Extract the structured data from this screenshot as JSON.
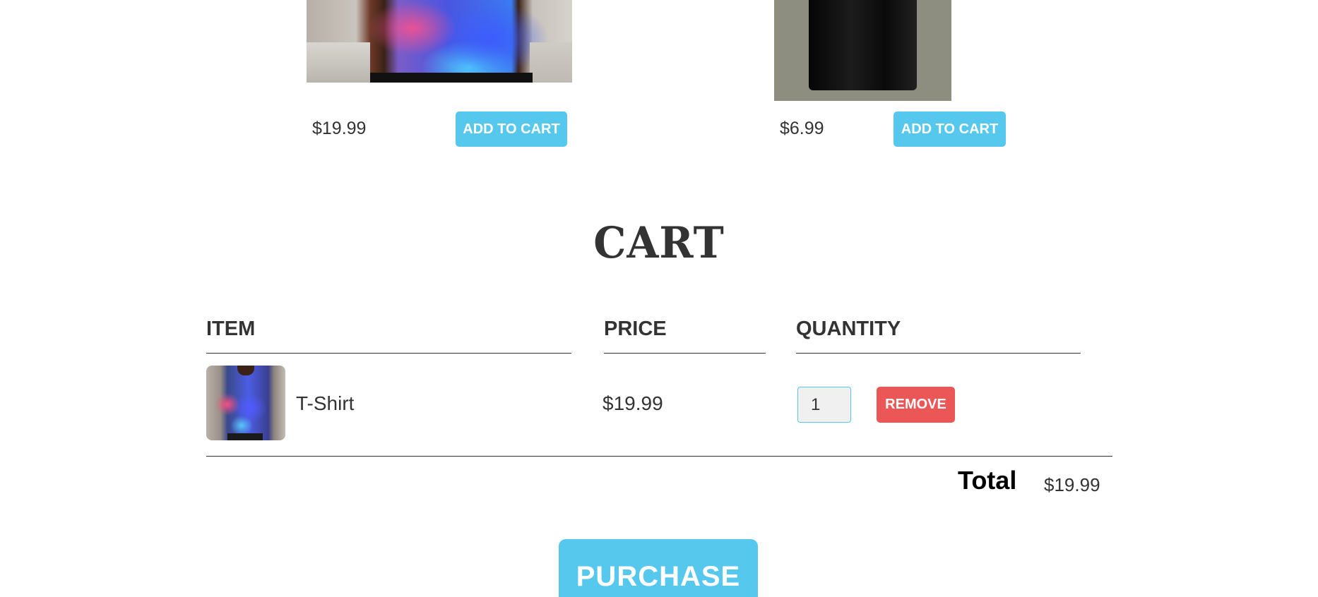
{
  "products": [
    {
      "image_alt": "T-Shirt",
      "price": "$19.99",
      "add_to_cart_label": "ADD TO CART"
    },
    {
      "image_alt": "Dress",
      "price": "$6.99",
      "add_to_cart_label": "ADD TO CART"
    }
  ],
  "cart": {
    "title": "CART",
    "columns": {
      "item": "ITEM",
      "price": "PRICE",
      "quantity": "QUANTITY"
    },
    "rows": [
      {
        "name": "T-Shirt",
        "price": "$19.99",
        "quantity": "1",
        "remove_label": "REMOVE"
      }
    ],
    "total_label": "Total",
    "total_value": "$19.99",
    "purchase_label": "PURCHASE"
  },
  "colors": {
    "accent": "#56c8ee",
    "danger": "#eb5757",
    "text": "#333333"
  }
}
